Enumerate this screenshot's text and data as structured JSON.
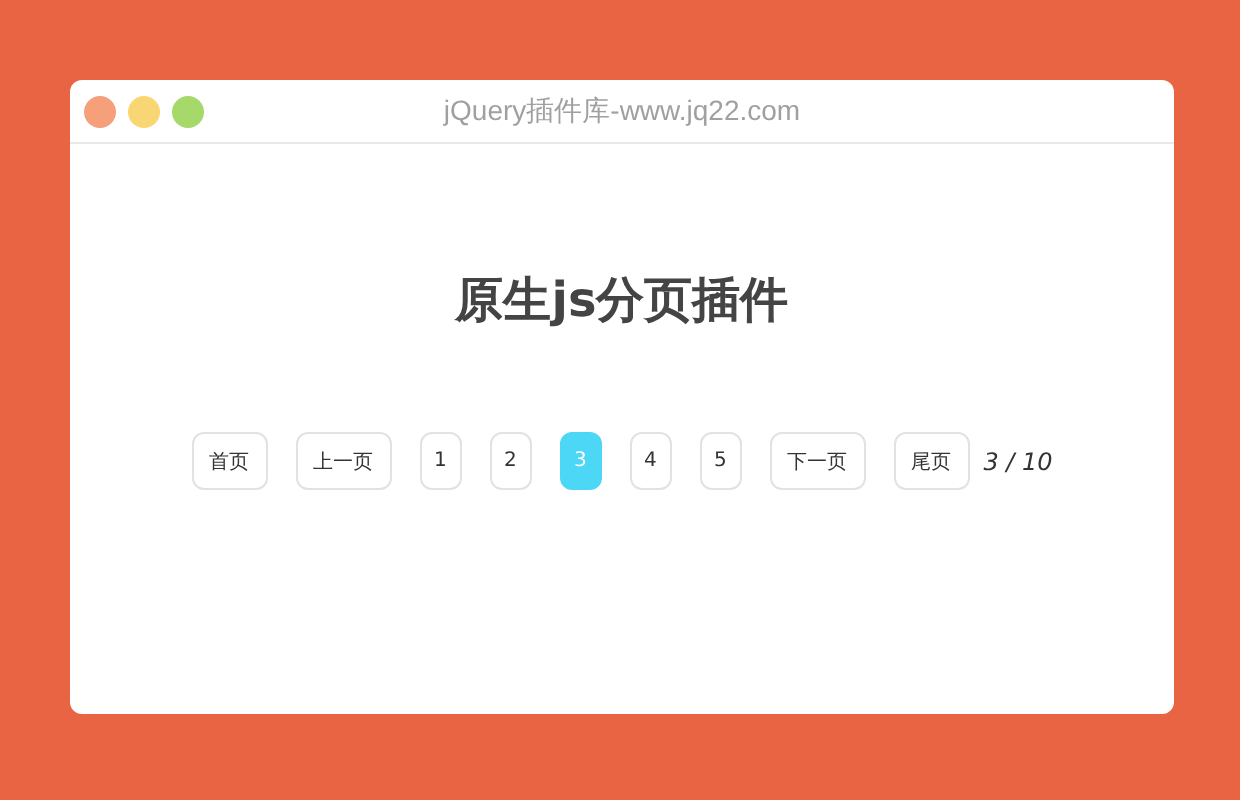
{
  "window": {
    "title": "jQuery插件库-www.jq22.com"
  },
  "heading": "原生js分页插件",
  "pagination": {
    "buttons": [
      {
        "label": "首页",
        "kind": "nav",
        "selected": false
      },
      {
        "label": "上一页",
        "kind": "nav",
        "selected": false
      },
      {
        "label": "1",
        "kind": "page",
        "selected": false
      },
      {
        "label": "2",
        "kind": "page",
        "selected": false
      },
      {
        "label": "3",
        "kind": "page",
        "selected": true
      },
      {
        "label": "4",
        "kind": "page",
        "selected": false
      },
      {
        "label": "5",
        "kind": "page",
        "selected": false
      },
      {
        "label": "下一页",
        "kind": "nav",
        "selected": false
      },
      {
        "label": "尾页",
        "kind": "nav",
        "selected": false
      }
    ],
    "counter": "3 / 10"
  }
}
